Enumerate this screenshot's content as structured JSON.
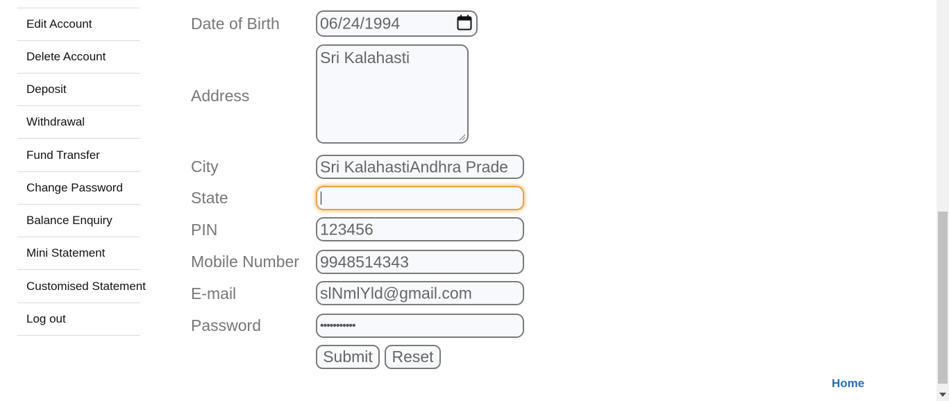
{
  "sidebar": {
    "items": [
      {
        "label": "Edit Account"
      },
      {
        "label": "Delete Account"
      },
      {
        "label": "Deposit"
      },
      {
        "label": "Withdrawal"
      },
      {
        "label": "Fund Transfer"
      },
      {
        "label": "Change Password"
      },
      {
        "label": "Balance Enquiry"
      },
      {
        "label": "Mini Statement"
      },
      {
        "label": "Customised Statement"
      },
      {
        "label": "Log out"
      }
    ]
  },
  "form": {
    "dob": {
      "label": "Date of Birth",
      "value": "06/24/1994",
      "icon": "calendar-icon"
    },
    "address": {
      "label": "Address",
      "value": "Sri Kalahasti"
    },
    "city": {
      "label": "City",
      "value": "Sri KalahastiAndhra Prade"
    },
    "state": {
      "label": "State",
      "value": ""
    },
    "pin": {
      "label": "PIN",
      "value": "123456"
    },
    "mobile": {
      "label": "Mobile Number",
      "value": "9948514343"
    },
    "email": {
      "label": "E-mail",
      "value": "slNmlYld@gmail.com"
    },
    "password": {
      "label": "Password",
      "value": "•••••••••••"
    },
    "submit_label": "Submit",
    "reset_label": "Reset"
  },
  "footer": {
    "home_label": "Home"
  },
  "colors": {
    "label": "#777777",
    "link": "#2a6db5",
    "focus": "#e8a24a"
  }
}
